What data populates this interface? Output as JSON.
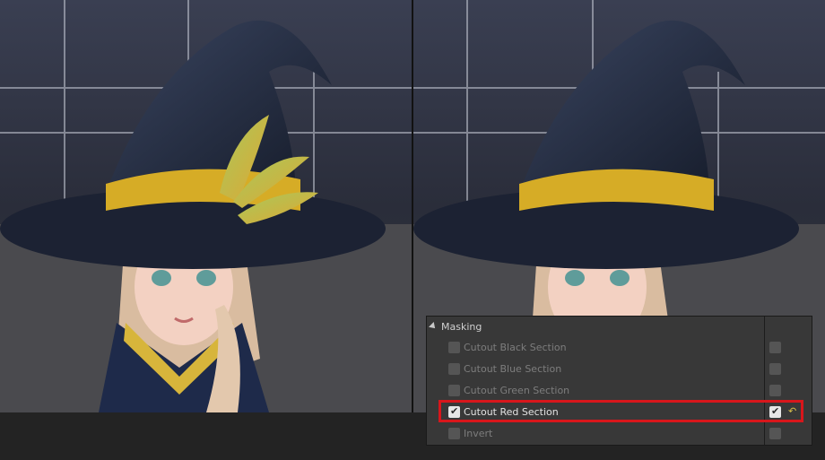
{
  "masking_panel": {
    "title": "Masking",
    "expander_icon": "collapse-arrow-icon",
    "rows": [
      {
        "label": "Cutout Black Section",
        "checked": false,
        "highlighted": false
      },
      {
        "label": "Cutout Blue Section",
        "checked": false,
        "highlighted": false
      },
      {
        "label": "Cutout Green Section",
        "checked": false,
        "highlighted": false
      },
      {
        "label": "Cutout Red Section",
        "checked": true,
        "highlighted": true
      },
      {
        "label": "Invert",
        "checked": false,
        "highlighted": false
      }
    ],
    "reset_icon": "reset-arrow-icon",
    "highlight_color": "#d8161b"
  },
  "viewports": {
    "left": {
      "name": "character-viewport-before"
    },
    "right": {
      "name": "character-viewport-after"
    }
  }
}
